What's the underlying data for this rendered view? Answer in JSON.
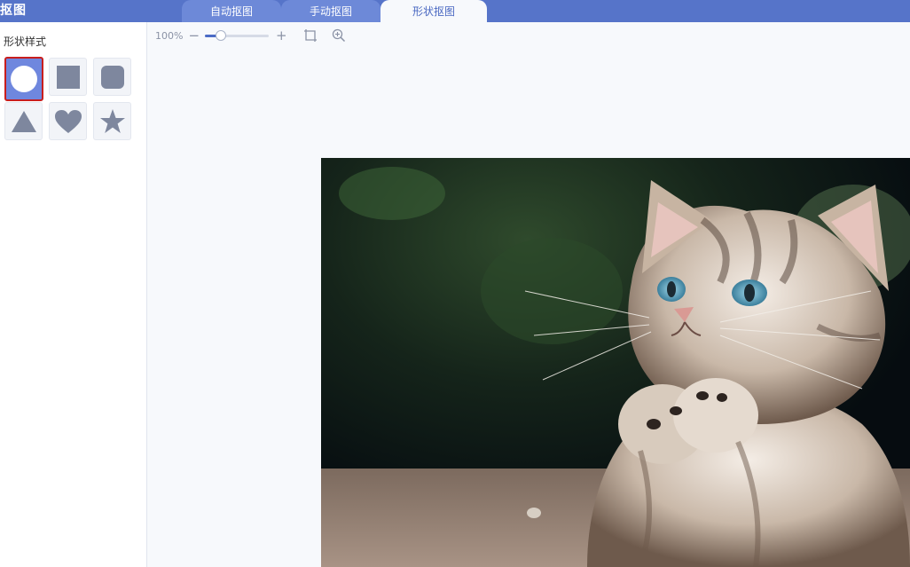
{
  "app": {
    "title": "抠图"
  },
  "tabs": [
    {
      "label": "自动抠图",
      "active": false
    },
    {
      "label": "手动抠图",
      "active": false
    },
    {
      "label": "形状抠图",
      "active": true
    }
  ],
  "shape_panel": {
    "label": "形状样式",
    "shapes": [
      {
        "name": "circle",
        "selected": true
      },
      {
        "name": "square",
        "selected": false
      },
      {
        "name": "rounded-square",
        "selected": false
      },
      {
        "name": "triangle",
        "selected": false
      },
      {
        "name": "heart",
        "selected": false
      },
      {
        "name": "star",
        "selected": false
      }
    ]
  },
  "zoom": {
    "value": "100%",
    "minus": "−",
    "plus": "+"
  },
  "colors": {
    "accent": "#5674c9",
    "selection_border": "#c81e1e",
    "shape_gray": "#7e879e",
    "selected_fill": "#6f87de"
  }
}
